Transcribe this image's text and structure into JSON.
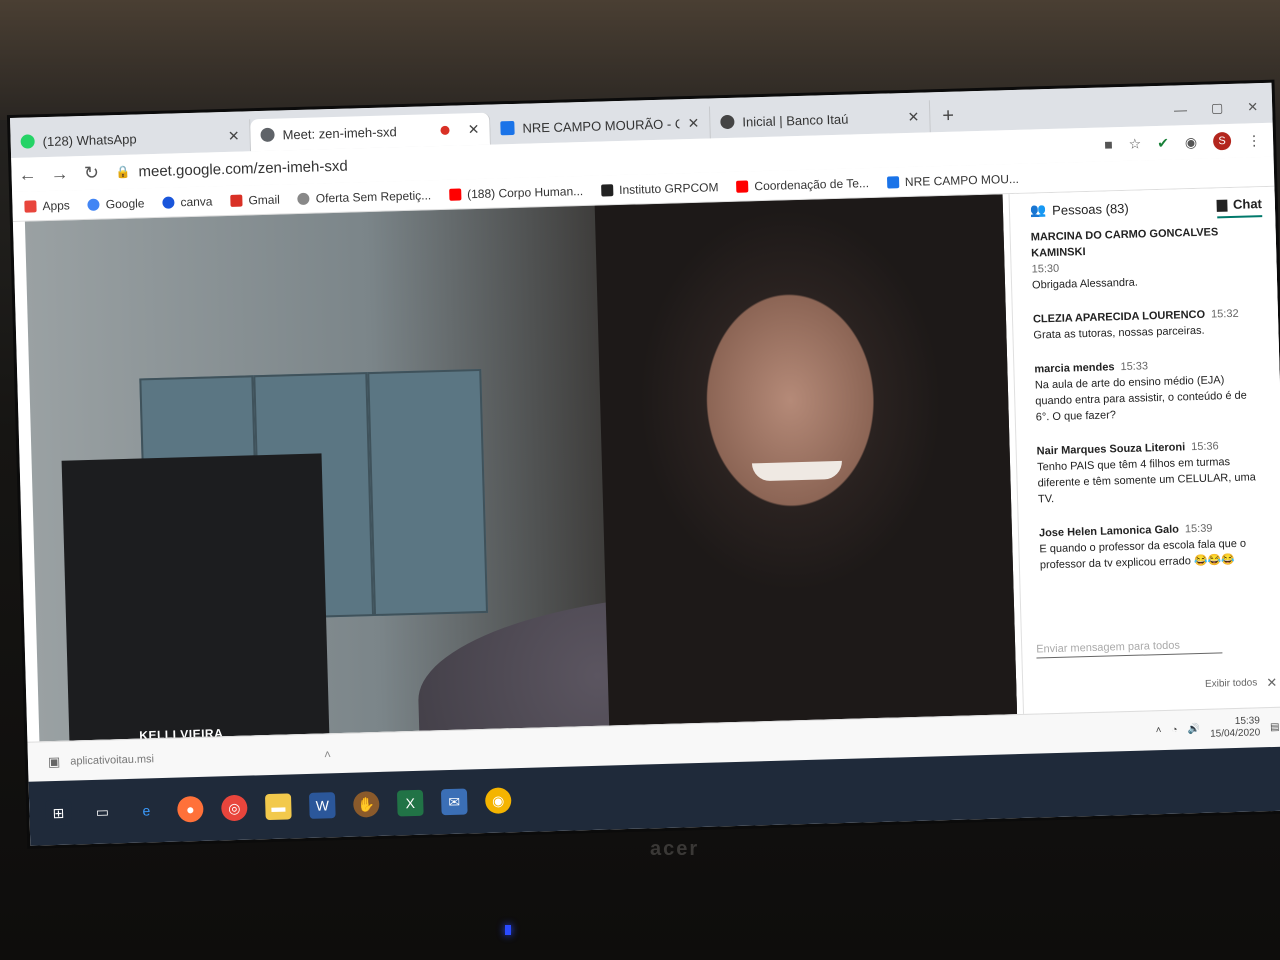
{
  "tabs": [
    {
      "label": "(128) WhatsApp",
      "icon_color": "#25d366",
      "active": false
    },
    {
      "label": "Meet: zen-imeh-sxd",
      "icon_color": "#5f6368",
      "active": true
    },
    {
      "label": "NRE CAMPO MOURÃO - Classro",
      "icon_color": "#1a73e8",
      "active": false
    },
    {
      "label": "Inicial | Banco Itaú",
      "icon_color": "#444444",
      "active": false
    }
  ],
  "toolbar": {
    "url": "meet.google.com/zen-imeh-sxd",
    "profile_initial": "S"
  },
  "bookmarks": [
    {
      "label": "Apps",
      "color": "#e8453c"
    },
    {
      "label": "Google",
      "color": "#4285f4"
    },
    {
      "label": "canva",
      "color": "#1a56db"
    },
    {
      "label": "Gmail",
      "color": "#d93025"
    },
    {
      "label": "Oferta Sem Repetiç...",
      "color": "#888888"
    },
    {
      "label": "(188) Corpo Human...",
      "color": "#ff0000"
    },
    {
      "label": "Instituto GRPCOM",
      "color": "#222222"
    },
    {
      "label": "Coordenação de Te...",
      "color": "#ff0000"
    },
    {
      "label": "NRE CAMPO MOU...",
      "color": "#1a73e8"
    }
  ],
  "video": {
    "participant_name": "KELLI VIEIRA"
  },
  "panel": {
    "people_label": "Pessoas (83)",
    "chat_label": "Chat",
    "messages": [
      {
        "sender": "MARCINA DO CARMO GONCALVES KAMINSKI",
        "time": "15:30",
        "text": "Obrigada Alessandra."
      },
      {
        "sender": "CLEZIA APARECIDA LOURENCO",
        "time": "15:32",
        "text": "Grata as tutoras, nossas parceiras."
      },
      {
        "sender": "marcia mendes",
        "time": "15:33",
        "text": "Na aula de arte do ensino médio (EJA) quando entra para assistir, o conteúdo é de 6°. O que fazer?"
      },
      {
        "sender": "Nair Marques Souza Literoni",
        "time": "15:36",
        "text": "Tenho PAIS que têm 4 filhos em turmas diferente e têm somente um CELULAR, uma TV."
      },
      {
        "sender": "Jose Helen Lamonica Galo",
        "time": "15:39",
        "text": "E quando o professor da escola fala que o professor da tv explicou errado 😂😂😂"
      }
    ],
    "compose_placeholder": "Enviar mensagem para todos",
    "show_all": "Exibir todos"
  },
  "downloads": {
    "file": "aplicativoitau.msi"
  },
  "tray": {
    "time": "15:39",
    "date": "15/04/2020"
  },
  "brand": "acer"
}
